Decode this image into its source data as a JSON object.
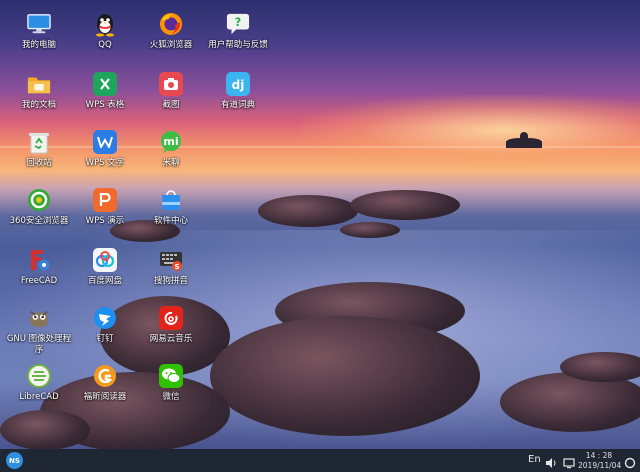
{
  "desktop": {
    "icons": [
      {
        "label": "我的电脑",
        "icon": "computer-icon"
      },
      {
        "label": "QQ",
        "icon": "qq-penguin-icon"
      },
      {
        "label": "火狐浏览器",
        "icon": "firefox-icon"
      },
      {
        "label": "用户帮助与反馈",
        "icon": "help-feedback-icon"
      },
      {
        "label": "我的文档",
        "icon": "folder-icon"
      },
      {
        "label": "WPS 表格",
        "icon": "wps-spreadsheet-icon"
      },
      {
        "label": "截图",
        "icon": "screenshot-icon"
      },
      {
        "label": "有道词典",
        "icon": "youdao-dict-icon"
      },
      {
        "label": "回收站",
        "icon": "recycle-bin-icon"
      },
      {
        "label": "WPS 文字",
        "icon": "wps-writer-icon"
      },
      {
        "label": "米聊",
        "icon": "miliao-icon"
      },
      {
        "label": "360安全浏览器",
        "icon": "360-browser-icon"
      },
      {
        "label": "WPS 演示",
        "icon": "wps-presentation-icon"
      },
      {
        "label": "软件中心",
        "icon": "software-center-icon"
      },
      {
        "label": "FreeCAD",
        "icon": "freecad-icon"
      },
      {
        "label": "百度网盘",
        "icon": "baidu-netdisk-icon"
      },
      {
        "label": "搜狗拼音",
        "icon": "sogou-pinyin-icon"
      },
      {
        "label": "GNU 图像处理程序",
        "icon": "gimp-icon"
      },
      {
        "label": "钉钉",
        "icon": "dingtalk-icon"
      },
      {
        "label": "网易云音乐",
        "icon": "netease-music-icon"
      },
      {
        "label": "LibreCAD",
        "icon": "librecad-icon"
      },
      {
        "label": "福昕阅读器",
        "icon": "foxit-reader-icon"
      },
      {
        "label": "微信",
        "icon": "wechat-icon"
      }
    ]
  },
  "taskbar": {
    "start_label": "NS",
    "lang": "En",
    "time": "14 : 28",
    "date": "2019/11/04"
  },
  "colors": {
    "taskbar_bg": "#1f2734",
    "start_accent": "#2f8ee0"
  }
}
